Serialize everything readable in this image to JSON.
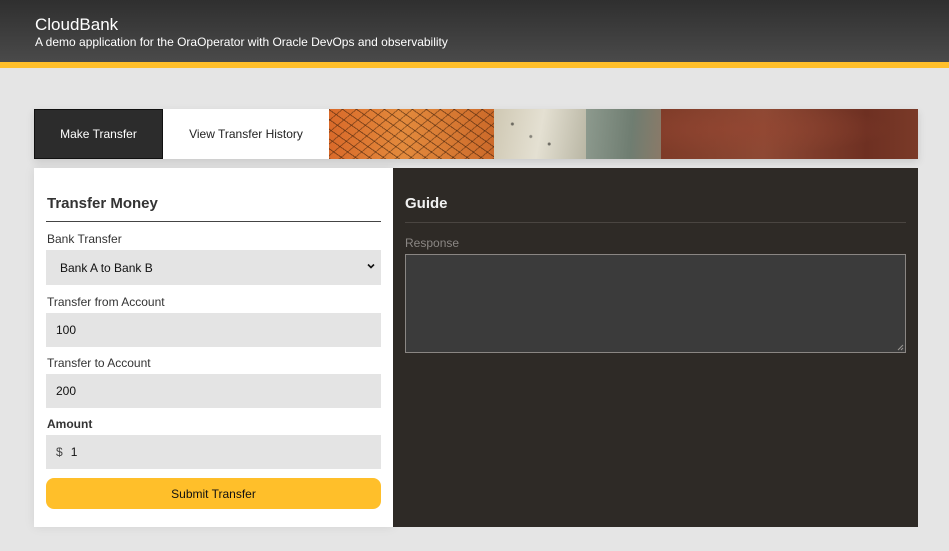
{
  "header": {
    "title": "CloudBank",
    "subtitle": "A demo application for the OraOperator with Oracle DevOps and observability"
  },
  "tabs": [
    {
      "label": "Make Transfer",
      "active": true
    },
    {
      "label": "View Transfer History",
      "active": false
    }
  ],
  "form": {
    "title": "Transfer Money",
    "bank_transfer": {
      "label": "Bank Transfer",
      "selected": "Bank A to Bank B"
    },
    "from_account": {
      "label": "Transfer from Account",
      "value": "100"
    },
    "to_account": {
      "label": "Transfer to Account",
      "value": "200"
    },
    "amount": {
      "label": "Amount",
      "currency": "$",
      "value": "1"
    },
    "submit_label": "Submit Transfer"
  },
  "guide": {
    "title": "Guide",
    "response_label": "Response",
    "response_value": ""
  },
  "colors": {
    "accent": "#ffbf2a",
    "header_bg": "#3a3a3a",
    "guide_bg": "#2e2a26",
    "page_bg": "#e5e5e5"
  }
}
